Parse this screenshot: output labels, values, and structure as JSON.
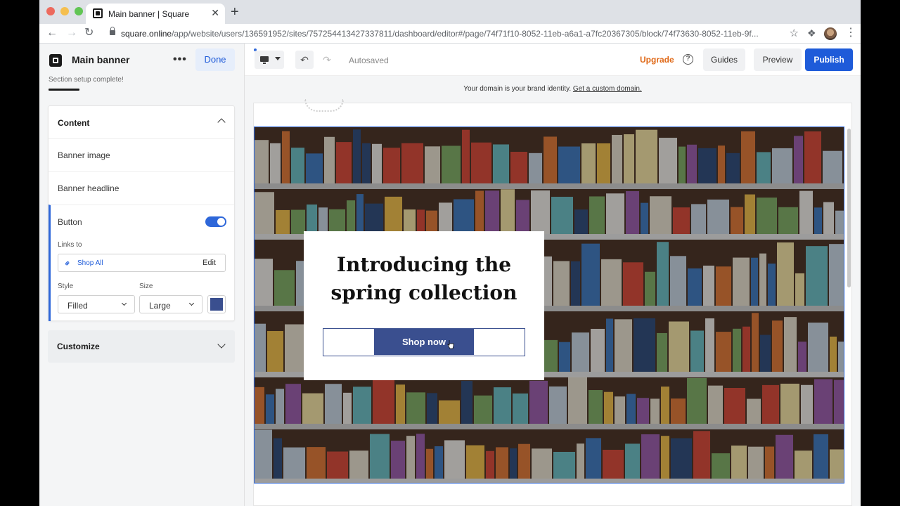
{
  "browser": {
    "tab_title": "Main banner | Square",
    "tab_close": "✕",
    "new_tab": "+",
    "url_host": "square.online",
    "url_path": "/app/website/users/136591952/sites/757254413427337811/dashboard/editor#/page/74f71f10-8052-11eb-a6a1-a7fc20367305/block/74f73630-8052-11eb-9f..."
  },
  "sidebar": {
    "title": "Main banner",
    "more": "•••",
    "done_label": "Done",
    "progress_text": "Section setup complete!",
    "content_heading": "Content",
    "rows": [
      "Banner image",
      "Banner headline"
    ],
    "button_label": "Button",
    "button_enabled": true,
    "links_to_label": "Links to",
    "link_value": "Shop All",
    "link_edit": "Edit",
    "style_label": "Style",
    "style_value": "Filled",
    "size_label": "Size",
    "size_value": "Large",
    "button_color": "#3a4f8f",
    "customize_heading": "Customize"
  },
  "editor_bar": {
    "autosaved": "Autosaved",
    "upgrade": "Upgrade",
    "help": "?",
    "guides": "Guides",
    "preview": "Preview",
    "publish": "Publish"
  },
  "canvas": {
    "domain_note": "Your domain is your brand identity.",
    "domain_link": "Get a custom domain.",
    "headline": "Introducing the spring collection",
    "cta": "Shop now"
  },
  "colors": {
    "accent": "#1e5bd9",
    "upgrade": "#e06a19",
    "cta": "#3a4f8f"
  }
}
